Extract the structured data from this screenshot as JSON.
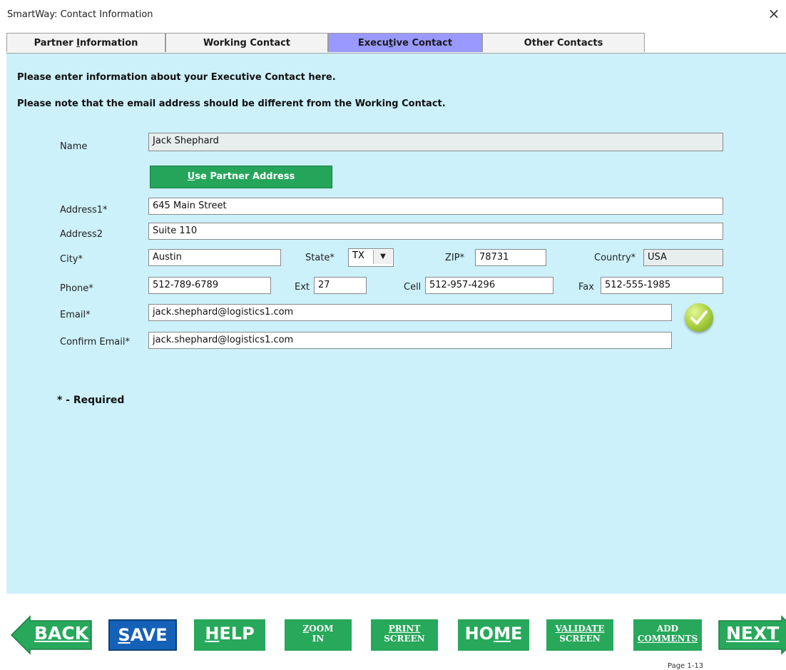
{
  "window": {
    "title": "SmartWay: Contact Information",
    "close": "×"
  },
  "tabs": [
    {
      "pre": "Partner ",
      "u": "I",
      "post": "nformation",
      "active": false
    },
    {
      "pre": "Working Contact",
      "u": "",
      "post": "",
      "active": false
    },
    {
      "pre": "Execu",
      "u": "t",
      "post": "ive Contact",
      "active": true
    },
    {
      "pre": "Other Contacts",
      "u": "",
      "post": "",
      "active": false
    }
  ],
  "instructions": {
    "line1": "Please enter information about your Executive Contact here.",
    "line2": "Please note that the email address should be different from the Working Contact."
  },
  "form": {
    "name_label": "Name",
    "name_value": "Jack Shephard",
    "use_partner_btn": {
      "u": "U",
      "rest": "se Partner Address"
    },
    "address1_label": "Address1*",
    "address1_value": "645 Main Street",
    "address2_label": "Address2",
    "address2_value": "Suite 110",
    "city_label": "City*",
    "city_value": "Austin",
    "state_label": "State*",
    "state_value": "TX",
    "zip_label": "ZIP*",
    "zip_value": "78731",
    "country_label": "Country*",
    "country_value": "USA",
    "phone_label": "Phone*",
    "phone_value": "512-789-6789",
    "ext_label": "Ext",
    "ext_value": "27",
    "cell_label": "Cell",
    "cell_value": "512-957-4296",
    "fax_label": "Fax",
    "fax_value": "512-555-1985",
    "email_label": "Email*",
    "email_value": "jack.shephard@logistics1.com",
    "confirm_email_label": "Confirm Email*",
    "confirm_email_value": "jack.shephard@logistics1.com",
    "required_note": "* - Required"
  },
  "bottom": {
    "back": "BACK",
    "save": {
      "u": "S",
      "rest": "AVE"
    },
    "help": {
      "u": "H",
      "rest": "ELP"
    },
    "zoom": {
      "u": "Z",
      "line1_rest": "OOM",
      "line2": "IN"
    },
    "print": {
      "line1": "PRINT",
      "line2": "SCREEN"
    },
    "home": {
      "pre": "HO",
      "u": "M",
      "post": "E"
    },
    "validate": {
      "line1": "VALIDATE",
      "line2": "SCREEN"
    },
    "add_comments": {
      "line1": "ADD",
      "line2": "COMMENTS"
    },
    "next": "NEXT",
    "page_label": "Page 1-13"
  },
  "colors": {
    "panel": "#ccf1fa",
    "active_tab": "#9999ff",
    "green": "#27a85a",
    "blue": "#1661b8"
  }
}
